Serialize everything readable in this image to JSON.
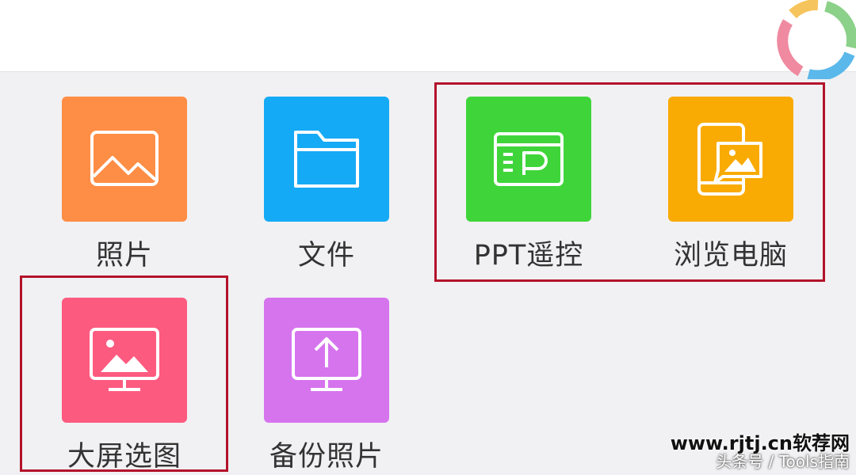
{
  "apps": [
    {
      "label": "照片",
      "icon": "photo-icon",
      "color": "#fe8d45"
    },
    {
      "label": "文件",
      "icon": "folder-icon",
      "color": "#15aaf5"
    },
    {
      "label": "PPT遥控",
      "icon": "ppt-remote-icon",
      "color": "#3fd53a"
    },
    {
      "label": "浏览电脑",
      "icon": "browse-computer-icon",
      "color": "#f9ab04"
    },
    {
      "label": "大屏选图",
      "icon": "big-screen-image-icon",
      "color": "#fd5a80"
    },
    {
      "label": "备份照片",
      "icon": "backup-photo-icon",
      "color": "#d674ee"
    }
  ],
  "highlight_color": "#b3122a",
  "watermark": {
    "site": "www.rjtj.cn软荐网",
    "source": "头条号 / Tools指南"
  }
}
